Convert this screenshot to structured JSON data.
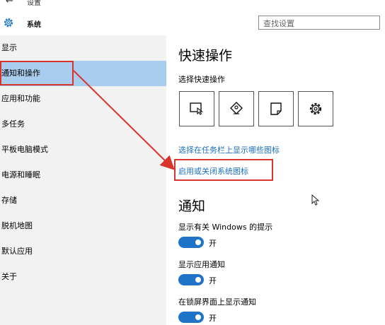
{
  "window": {
    "back_glyph": "←",
    "title": "设置",
    "min_glyph": "—"
  },
  "header": {
    "section_title": "系统",
    "search_placeholder": "查找设置"
  },
  "sidebar": {
    "items": [
      {
        "label": "显示"
      },
      {
        "label": "通知和操作"
      },
      {
        "label": "应用和功能"
      },
      {
        "label": "多任务"
      },
      {
        "label": "平板电脑模式"
      },
      {
        "label": "电源和睡眠"
      },
      {
        "label": "存储"
      },
      {
        "label": "脱机地图"
      },
      {
        "label": "默认应用"
      },
      {
        "label": "关于"
      }
    ],
    "selected_index": 1
  },
  "main": {
    "quick_actions_title": "快速操作",
    "quick_actions_subtitle": "选择快速操作",
    "quick_tiles": [
      {
        "icon": "tablet-mode-icon"
      },
      {
        "icon": "location-icon"
      },
      {
        "icon": "note-icon"
      },
      {
        "icon": "settings-gear-icon"
      }
    ],
    "link_taskbar_icons": "选择在任务栏上显示哪些图标",
    "link_system_icons": "启用或关闭系统图标",
    "notifications_title": "通知",
    "settings": [
      {
        "label": "显示有关 Windows 的提示",
        "state": "开"
      },
      {
        "label": "显示应用通知",
        "state": "开"
      },
      {
        "label": "在锁屏界面上显示通知",
        "state": "开"
      }
    ]
  },
  "colors": {
    "accent": "#1f74c8",
    "link": "#1a6fc1",
    "selection": "#a9cdef",
    "annotation": "#d9342b"
  }
}
